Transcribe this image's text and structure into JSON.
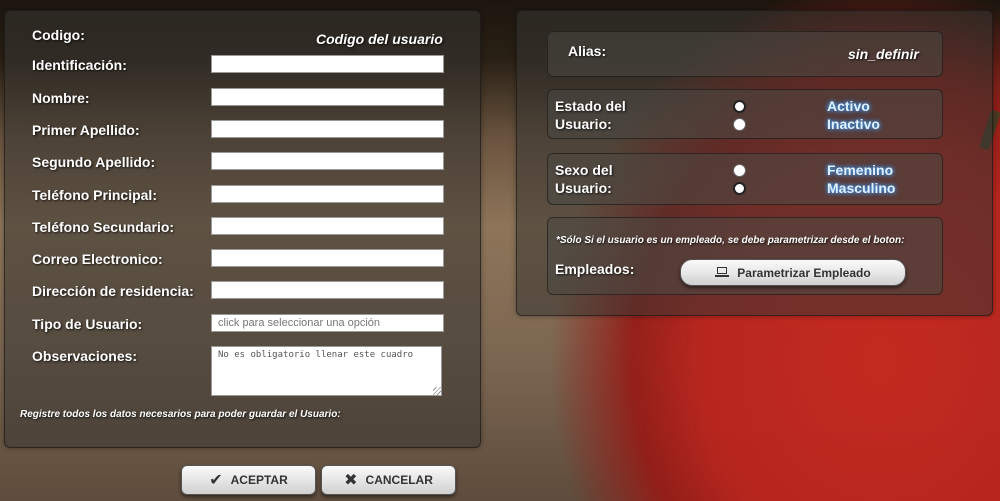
{
  "form": {
    "codigo_label": "Codigo:",
    "codigo_value": "Codigo del usuario",
    "fields": [
      {
        "label": "Identificación:",
        "value": ""
      },
      {
        "label": "Nombre:",
        "value": ""
      },
      {
        "label": "Primer Apellido:",
        "value": ""
      },
      {
        "label": "Segundo Apellido:",
        "value": ""
      },
      {
        "label": "Teléfono Principal:",
        "value": ""
      },
      {
        "label": "Teléfono Secundario:",
        "value": ""
      },
      {
        "label": "Correo Electronico:",
        "value": ""
      },
      {
        "label": "Dirección de residencia:",
        "value": ""
      }
    ],
    "tipo_usuario": {
      "label": "Tipo de Usuario:",
      "placeholder": "click para seleccionar una opción"
    },
    "observaciones": {
      "label": "Observaciones:",
      "placeholder": "No es obligatorio llenar este cuadro"
    },
    "footer_note": "Registre todos los datos necesarios para poder guardar el Usuario:"
  },
  "buttons": {
    "aceptar": "ACEPTAR",
    "cancelar": "CANCELAR"
  },
  "right": {
    "alias_label": "Alias:",
    "alias_value": "sin_definir",
    "estado": {
      "label_line1": "Estado del",
      "label_line2": "Usuario:",
      "options": [
        "Activo",
        "Inactivo"
      ],
      "selected": "Activo"
    },
    "sexo": {
      "label_line1": "Sexo del",
      "label_line2": "Usuario:",
      "options": [
        "Femenino",
        "Masculino"
      ],
      "selected": "Masculino"
    },
    "empleados": {
      "note": "*Sólo Si el usuario es un empleado, se debe parametrizar desde el boton:",
      "label": "Empleados:",
      "button_label": "Parametrizar Empleado"
    }
  },
  "icons": {
    "aceptar_icon": "checkmark-icon",
    "cancelar_icon": "x-icon",
    "parametrizar_icon": "laptop-icon"
  }
}
